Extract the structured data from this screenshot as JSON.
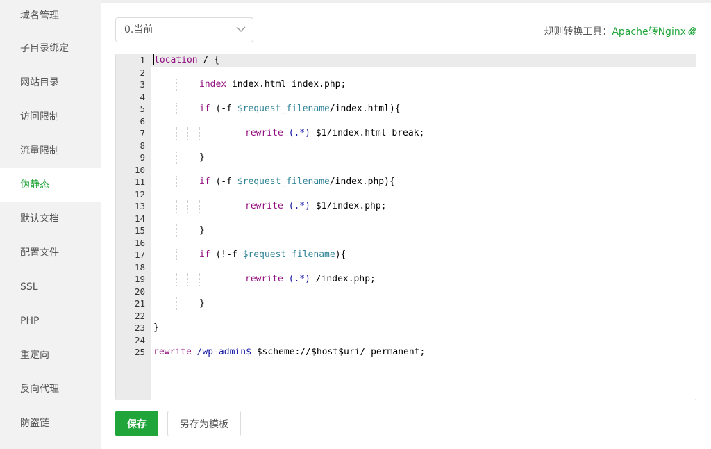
{
  "sidebar": {
    "items": [
      {
        "label": "域名管理",
        "active": false
      },
      {
        "label": "子目录绑定",
        "active": false
      },
      {
        "label": "网站目录",
        "active": false
      },
      {
        "label": "访问限制",
        "active": false
      },
      {
        "label": "流量限制",
        "active": false
      },
      {
        "label": "伪静态",
        "active": true
      },
      {
        "label": "默认文档",
        "active": false
      },
      {
        "label": "配置文件",
        "active": false
      },
      {
        "label": "SSL",
        "active": false
      },
      {
        "label": "PHP",
        "active": false
      },
      {
        "label": "重定向",
        "active": false
      },
      {
        "label": "反向代理",
        "active": false
      },
      {
        "label": "防盗链",
        "active": false
      }
    ]
  },
  "rule_select": {
    "value": "0.当前"
  },
  "converter": {
    "label": "规则转换工具：",
    "link": "Apache转Nginx",
    "icon": "paperclip-icon"
  },
  "editor": {
    "active_line": 1,
    "lines": [
      "location / {",
      "",
      "\tindex index.html index.php;",
      "",
      "\tif (-f $request_filename/index.html){",
      "",
      "\t\trewrite (.*) $1/index.html break;",
      "",
      "\t}",
      "",
      "\tif (-f $request_filename/index.php){",
      "",
      "\t\trewrite (.*) $1/index.php;",
      "",
      "\t}",
      "",
      "\tif (!-f $request_filename){",
      "",
      "\t\trewrite (.*) /index.php;",
      "",
      "\t}",
      "",
      "}",
      "",
      "rewrite /wp-admin$ $scheme://$host$uri/ permanent;"
    ]
  },
  "buttons": {
    "save": "保存",
    "save_as_template": "另存为模板"
  },
  "colors": {
    "accent": "#20a53a",
    "keyword": "#930f80",
    "variable": "#318495",
    "regex": "#1a1aa6"
  }
}
